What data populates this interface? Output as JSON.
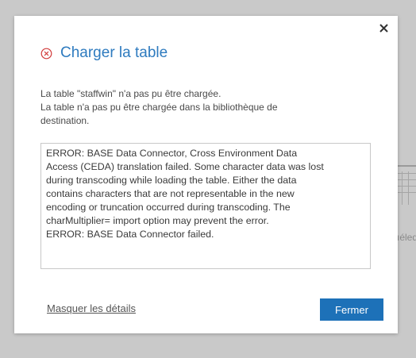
{
  "background": {
    "partial_text": "ıéled"
  },
  "dialog": {
    "title": "Charger la table",
    "close_icon": "close-icon",
    "status_icon": "error-circle-icon",
    "message_lines": [
      "La table \"staffwin\" n'a pas pu être chargée.",
      "La table n'a pas pu être chargée dans la bibliothèque de",
      "destination."
    ],
    "details_lines": [
      "ERROR: BASE Data Connector, Cross Environment Data",
      "Access (CEDA) translation failed. Some character data was lost",
      "during transcoding while loading the table. Either the data",
      "contains characters that are not representable in the new",
      "encoding or truncation occurred during transcoding. The",
      "charMultiplier= import option may prevent the error.",
      "ERROR: BASE Data Connector failed."
    ],
    "hide_details_label": "Masquer les détails",
    "close_button_label": "Fermer"
  },
  "colors": {
    "accent": "#1d71b8",
    "title": "#2e7bbf",
    "error": "#d13a3a",
    "overlay": "#c9c9c9"
  }
}
